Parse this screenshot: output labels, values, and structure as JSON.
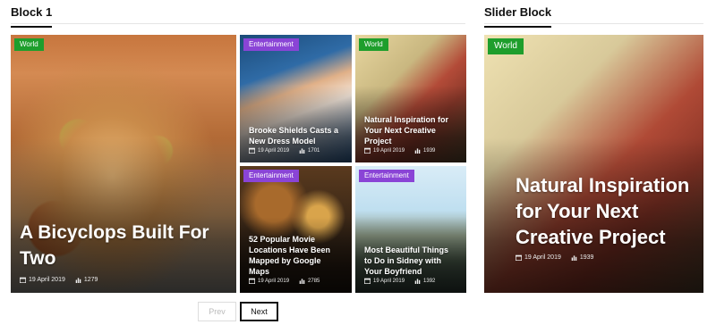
{
  "block1": {
    "title": "Block 1"
  },
  "slider_block": {
    "title": "Slider Block"
  },
  "cards": {
    "main": {
      "category": "World",
      "title": "A Bicyclops Built For Two",
      "date": "19 April 2019",
      "views": "1279"
    },
    "brooke": {
      "category": "Entertainment",
      "title": "Brooke Shields Casts a New Dress Model",
      "date": "19 April 2019",
      "views": "1701"
    },
    "inspo": {
      "category": "World",
      "title": "Natural Inspiration for Your Next Creative Project",
      "date": "19 April 2019",
      "views": "1939"
    },
    "movie": {
      "category": "Entertainment",
      "title": "52 Popular Movie Locations Have Been Mapped by Google Maps",
      "date": "19 April 2019",
      "views": "2785"
    },
    "sidney": {
      "category": "Entertainment",
      "title": "Most Beautiful Things to Do in Sidney with Your Boyfriend",
      "date": "19 April 2019",
      "views": "1392"
    },
    "slider": {
      "category": "World",
      "title": "Natural Inspiration for Your Next Creative Project",
      "date": "19 April 2019",
      "views": "1939"
    }
  },
  "pagination": {
    "prev_label": "Prev",
    "next_label": "Next"
  },
  "colors": {
    "world_tag": "#1e9e2c",
    "entertainment_tag": "#8a44d6"
  },
  "icons": {
    "date": "calendar-icon",
    "views": "bar-chart-icon"
  }
}
